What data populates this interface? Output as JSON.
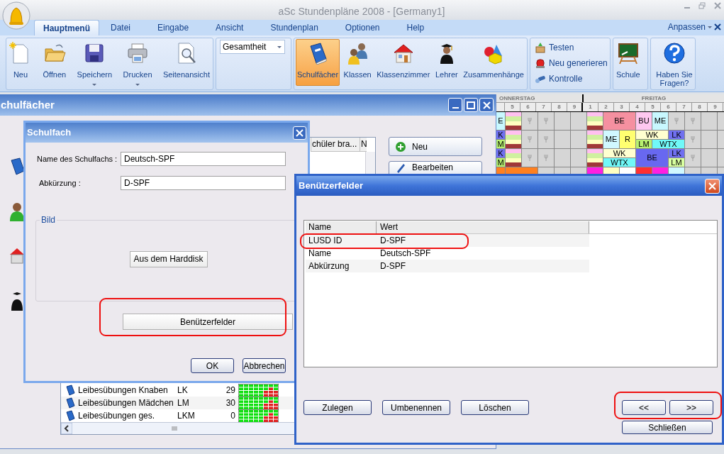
{
  "app": {
    "title": "aSc Stundenpläne 2008  - [Germany1]"
  },
  "menu_tabs": [
    {
      "label": "Hauptmenü",
      "selected": true
    },
    {
      "label": "Datei",
      "selected": false
    },
    {
      "label": "Eingabe",
      "selected": false
    },
    {
      "label": "Ansicht",
      "selected": false
    },
    {
      "label": "Stundenplan",
      "selected": false
    },
    {
      "label": "Optionen",
      "selected": false
    },
    {
      "label": "Help",
      "selected": false
    }
  ],
  "customize": "Anpassen",
  "ribbon": {
    "groups": [
      {
        "kind": "large",
        "items": [
          {
            "label": "Neu",
            "dropdown": false,
            "selected": false
          },
          {
            "label": "Öffnen",
            "dropdown": false,
            "selected": false
          },
          {
            "label": "Speichern",
            "dropdown": true,
            "selected": false
          },
          {
            "label": "Drucken",
            "dropdown": true,
            "selected": false
          },
          {
            "label": "Seitenansicht",
            "dropdown": false,
            "selected": false
          }
        ]
      },
      {
        "kind": "combo",
        "value": "Gesamtheit"
      },
      {
        "kind": "large",
        "items": [
          {
            "label": "Schulfächer",
            "dropdown": false,
            "selected": true
          },
          {
            "label": "Klassen",
            "dropdown": false,
            "selected": false
          },
          {
            "label": "Klassenzimmer",
            "dropdown": false,
            "selected": false
          },
          {
            "label": "Lehrer",
            "dropdown": false,
            "selected": false
          },
          {
            "label": "Zusammenhänge",
            "dropdown": false,
            "selected": false
          }
        ]
      },
      {
        "kind": "small",
        "items": [
          {
            "label": "Testen"
          },
          {
            "label": "Neu generieren"
          },
          {
            "label": "Kontrolle"
          }
        ]
      },
      {
        "kind": "large",
        "items": [
          {
            "label": "Schule",
            "dropdown": false,
            "selected": false
          }
        ]
      },
      {
        "kind": "large",
        "items": [
          {
            "label": "Haben Sie Fragen?",
            "dropdown": false,
            "selected": false
          }
        ]
      }
    ]
  },
  "timetable": {
    "days": [
      {
        "label": "ONNERSTAG",
        "periods": [
          "5",
          "6",
          "7",
          "8",
          "9"
        ]
      },
      {
        "label": "FREITAG",
        "periods": [
          "1",
          "2",
          "3",
          "4",
          "5",
          "6",
          "7",
          "8",
          "9"
        ]
      }
    ],
    "rows": [
      {
        "slots": [
          {
            "kind": "lesson",
            "text": "E",
            "color": "#c8f8ff"
          },
          {
            "kind": "stack",
            "parts": [
              {
                "color": "#ffc0f0"
              },
              {
                "color": "#d0f0a0"
              },
              {
                "color": "#ffffc0"
              },
              {
                "color": "#a03838"
              }
            ]
          },
          {
            "kind": "blocked"
          },
          {
            "kind": "blocked"
          },
          {
            "kind": "empty"
          },
          {
            "kind": "empty"
          },
          {
            "kind": "stack",
            "parts": [
              {
                "color": "#ffc0f0"
              },
              {
                "color": "#d0f0a0"
              },
              {
                "color": "#ffffc0"
              },
              {
                "color": "#a03838"
              }
            ]
          },
          {
            "kind": "lesson",
            "text": "BE",
            "color": "#f590a0",
            "colspan": 2
          },
          {
            "kind": "lesson",
            "text": "BU",
            "color": "#ffc8f0"
          },
          {
            "kind": "lesson",
            "text": "ME",
            "color": "#c8f8ff"
          },
          {
            "kind": "blocked"
          },
          {
            "kind": "blocked"
          },
          {
            "kind": "empty"
          },
          {
            "kind": "empty"
          }
        ]
      },
      {
        "slots": [
          {
            "kind": "split",
            "top": [
              {
                "text": "K",
                "color": "#7070f0"
              }
            ],
            "bottom": [
              {
                "text": "M",
                "color": "#b8f070"
              }
            ]
          },
          {
            "kind": "stack",
            "parts": [
              {
                "color": "#ffc0f0"
              },
              {
                "color": "#d0f0a0"
              },
              {
                "color": "#ffffc0"
              },
              {
                "color": "#a03838"
              }
            ]
          },
          {
            "kind": "blocked"
          },
          {
            "kind": "blocked"
          },
          {
            "kind": "empty"
          },
          {
            "kind": "empty"
          },
          {
            "kind": "stack",
            "parts": [
              {
                "color": "#ffc0f0"
              },
              {
                "color": "#d0f0a0"
              },
              {
                "color": "#ffffc0"
              },
              {
                "color": "#a03838"
              }
            ]
          },
          {
            "kind": "lesson",
            "text": "ME",
            "color": "#d0f8ff"
          },
          {
            "kind": "lesson",
            "text": "R",
            "color": "#ffff70"
          },
          {
            "kind": "split",
            "colspan": 3,
            "top": [
              {
                "text": "WK",
                "color": "#ffffd0",
                "colspan": 2
              },
              {
                "text": "LK",
                "color": "#7070f0"
              }
            ],
            "bottom": [
              {
                "text": "LM",
                "color": "#b8f070"
              },
              {
                "text": "WTX",
                "color": "#70f8f8",
                "colspan": 2
              }
            ]
          },
          {
            "kind": "blocked"
          },
          {
            "kind": "empty"
          },
          {
            "kind": "empty"
          }
        ]
      },
      {
        "slots": [
          {
            "kind": "split",
            "top": [
              {
                "text": "K",
                "color": "#7070f0"
              }
            ],
            "bottom": [
              {
                "text": "M",
                "color": "#b8f070"
              }
            ]
          },
          {
            "kind": "stack",
            "parts": [
              {
                "color": "#ffc0f0"
              },
              {
                "color": "#d0f0a0"
              },
              {
                "color": "#ffffc0"
              },
              {
                "color": "#a03838"
              }
            ]
          },
          {
            "kind": "blocked"
          },
          {
            "kind": "blocked"
          },
          {
            "kind": "empty"
          },
          {
            "kind": "empty"
          },
          {
            "kind": "stack",
            "parts": [
              {
                "color": "#ffc0f0"
              },
              {
                "color": "#d0f0a0"
              },
              {
                "color": "#ffffc0"
              },
              {
                "color": "#a03838"
              }
            ]
          },
          {
            "kind": "split",
            "colspan": 2,
            "top": [
              {
                "text": "WK",
                "color": "#ffffd0",
                "colspan": 2
              }
            ],
            "bottom": [
              {
                "text": "WTX",
                "color": "#70f8f8",
                "colspan": 2
              }
            ]
          },
          {
            "kind": "lesson",
            "text": "BE",
            "color": "#6868f0",
            "colspan": 2
          },
          {
            "kind": "split",
            "top": [
              {
                "text": "LK",
                "color": "#7070f0"
              }
            ],
            "bottom": [
              {
                "text": "LM",
                "color": "#d8ffa0"
              }
            ]
          },
          {
            "kind": "blocked"
          },
          {
            "kind": "empty"
          },
          {
            "kind": "empty"
          }
        ]
      },
      {
        "slots": [
          {
            "kind": "lesson",
            "color": "#ff8020"
          },
          {
            "kind": "lesson",
            "color": "#ff8020",
            "colspan": 2
          },
          {
            "kind": "empty"
          },
          {
            "kind": "empty"
          },
          {
            "kind": "empty"
          },
          {
            "kind": "lesson",
            "color": "#ff20e0"
          },
          {
            "kind": "lesson",
            "color": "#ffffc0"
          },
          {
            "kind": "lesson",
            "color": "#ffffff"
          },
          {
            "kind": "lesson",
            "color": "#ff3030"
          },
          {
            "kind": "lesson",
            "color": "#ff20e0"
          },
          {
            "kind": "lesson",
            "color": "#d0f8ff"
          },
          {
            "kind": "empty"
          },
          {
            "kind": "empty"
          },
          {
            "kind": "empty"
          }
        ]
      }
    ]
  },
  "subjects_window": {
    "title": "chulfächer",
    "columns": [
      "chüler bra...",
      "N"
    ],
    "buttons": [
      "Neu",
      "Bearbeiten"
    ],
    "rows": [
      {
        "name": "Leibesübungen Knaben",
        "abbr": "LK",
        "count": "29"
      },
      {
        "name": "Leibesübungen Mädchen",
        "abbr": "LM",
        "count": "30"
      },
      {
        "name": "Leibesübungen ges.",
        "abbr": "LKM",
        "count": "0"
      }
    ]
  },
  "subject_dialog": {
    "title": "Schulfach",
    "fields": [
      {
        "label": "Name des Schulfachs :",
        "value": "Deutsch-SPF"
      },
      {
        "label": "Abkürzung :",
        "value": "D-SPF"
      }
    ],
    "group": "Bild",
    "image_button": "Aus dem Harddisk",
    "fields_button": "Benützerfelder",
    "buttons": [
      "OK",
      "Abbrechen"
    ]
  },
  "custom_fields_dialog": {
    "title": "Benützerfelder",
    "columns": [
      "Name",
      "Wert"
    ],
    "rows": [
      {
        "name": "LUSD ID",
        "value": "D-SPF"
      },
      {
        "name": "Name",
        "value": "Deutsch-SPF"
      },
      {
        "name": "Abkürzung",
        "value": "D-SPF"
      }
    ],
    "buttons": [
      "Zulegen",
      "Umbenennen",
      "Löschen"
    ],
    "nav_buttons": [
      "<<",
      ">>"
    ],
    "close_button": "Schließen"
  }
}
